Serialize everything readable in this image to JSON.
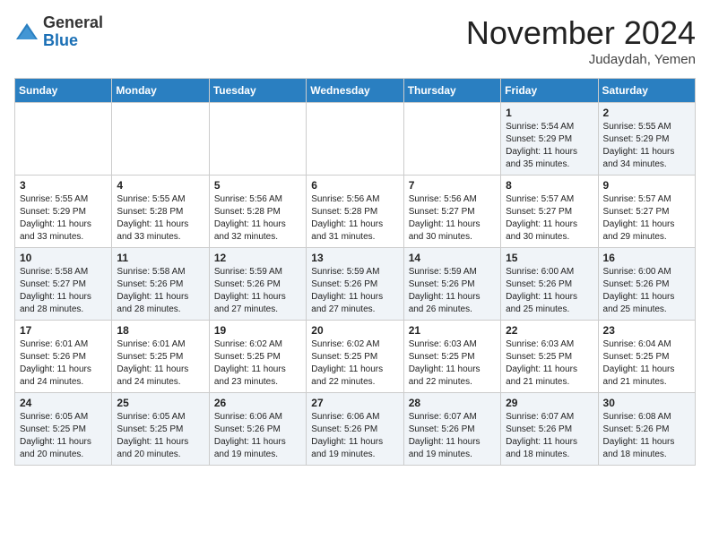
{
  "header": {
    "logo_line1": "General",
    "logo_line2": "Blue",
    "month": "November 2024",
    "location": "Judaydah, Yemen"
  },
  "weekdays": [
    "Sunday",
    "Monday",
    "Tuesday",
    "Wednesday",
    "Thursday",
    "Friday",
    "Saturday"
  ],
  "weeks": [
    [
      {
        "day": "",
        "info": ""
      },
      {
        "day": "",
        "info": ""
      },
      {
        "day": "",
        "info": ""
      },
      {
        "day": "",
        "info": ""
      },
      {
        "day": "",
        "info": ""
      },
      {
        "day": "1",
        "info": "Sunrise: 5:54 AM\nSunset: 5:29 PM\nDaylight: 11 hours\nand 35 minutes."
      },
      {
        "day": "2",
        "info": "Sunrise: 5:55 AM\nSunset: 5:29 PM\nDaylight: 11 hours\nand 34 minutes."
      }
    ],
    [
      {
        "day": "3",
        "info": "Sunrise: 5:55 AM\nSunset: 5:29 PM\nDaylight: 11 hours\nand 33 minutes."
      },
      {
        "day": "4",
        "info": "Sunrise: 5:55 AM\nSunset: 5:28 PM\nDaylight: 11 hours\nand 33 minutes."
      },
      {
        "day": "5",
        "info": "Sunrise: 5:56 AM\nSunset: 5:28 PM\nDaylight: 11 hours\nand 32 minutes."
      },
      {
        "day": "6",
        "info": "Sunrise: 5:56 AM\nSunset: 5:28 PM\nDaylight: 11 hours\nand 31 minutes."
      },
      {
        "day": "7",
        "info": "Sunrise: 5:56 AM\nSunset: 5:27 PM\nDaylight: 11 hours\nand 30 minutes."
      },
      {
        "day": "8",
        "info": "Sunrise: 5:57 AM\nSunset: 5:27 PM\nDaylight: 11 hours\nand 30 minutes."
      },
      {
        "day": "9",
        "info": "Sunrise: 5:57 AM\nSunset: 5:27 PM\nDaylight: 11 hours\nand 29 minutes."
      }
    ],
    [
      {
        "day": "10",
        "info": "Sunrise: 5:58 AM\nSunset: 5:27 PM\nDaylight: 11 hours\nand 28 minutes."
      },
      {
        "day": "11",
        "info": "Sunrise: 5:58 AM\nSunset: 5:26 PM\nDaylight: 11 hours\nand 28 minutes."
      },
      {
        "day": "12",
        "info": "Sunrise: 5:59 AM\nSunset: 5:26 PM\nDaylight: 11 hours\nand 27 minutes."
      },
      {
        "day": "13",
        "info": "Sunrise: 5:59 AM\nSunset: 5:26 PM\nDaylight: 11 hours\nand 27 minutes."
      },
      {
        "day": "14",
        "info": "Sunrise: 5:59 AM\nSunset: 5:26 PM\nDaylight: 11 hours\nand 26 minutes."
      },
      {
        "day": "15",
        "info": "Sunrise: 6:00 AM\nSunset: 5:26 PM\nDaylight: 11 hours\nand 25 minutes."
      },
      {
        "day": "16",
        "info": "Sunrise: 6:00 AM\nSunset: 5:26 PM\nDaylight: 11 hours\nand 25 minutes."
      }
    ],
    [
      {
        "day": "17",
        "info": "Sunrise: 6:01 AM\nSunset: 5:26 PM\nDaylight: 11 hours\nand 24 minutes."
      },
      {
        "day": "18",
        "info": "Sunrise: 6:01 AM\nSunset: 5:25 PM\nDaylight: 11 hours\nand 24 minutes."
      },
      {
        "day": "19",
        "info": "Sunrise: 6:02 AM\nSunset: 5:25 PM\nDaylight: 11 hours\nand 23 minutes."
      },
      {
        "day": "20",
        "info": "Sunrise: 6:02 AM\nSunset: 5:25 PM\nDaylight: 11 hours\nand 22 minutes."
      },
      {
        "day": "21",
        "info": "Sunrise: 6:03 AM\nSunset: 5:25 PM\nDaylight: 11 hours\nand 22 minutes."
      },
      {
        "day": "22",
        "info": "Sunrise: 6:03 AM\nSunset: 5:25 PM\nDaylight: 11 hours\nand 21 minutes."
      },
      {
        "day": "23",
        "info": "Sunrise: 6:04 AM\nSunset: 5:25 PM\nDaylight: 11 hours\nand 21 minutes."
      }
    ],
    [
      {
        "day": "24",
        "info": "Sunrise: 6:05 AM\nSunset: 5:25 PM\nDaylight: 11 hours\nand 20 minutes."
      },
      {
        "day": "25",
        "info": "Sunrise: 6:05 AM\nSunset: 5:25 PM\nDaylight: 11 hours\nand 20 minutes."
      },
      {
        "day": "26",
        "info": "Sunrise: 6:06 AM\nSunset: 5:26 PM\nDaylight: 11 hours\nand 19 minutes."
      },
      {
        "day": "27",
        "info": "Sunrise: 6:06 AM\nSunset: 5:26 PM\nDaylight: 11 hours\nand 19 minutes."
      },
      {
        "day": "28",
        "info": "Sunrise: 6:07 AM\nSunset: 5:26 PM\nDaylight: 11 hours\nand 19 minutes."
      },
      {
        "day": "29",
        "info": "Sunrise: 6:07 AM\nSunset: 5:26 PM\nDaylight: 11 hours\nand 18 minutes."
      },
      {
        "day": "30",
        "info": "Sunrise: 6:08 AM\nSunset: 5:26 PM\nDaylight: 11 hours\nand 18 minutes."
      }
    ]
  ]
}
